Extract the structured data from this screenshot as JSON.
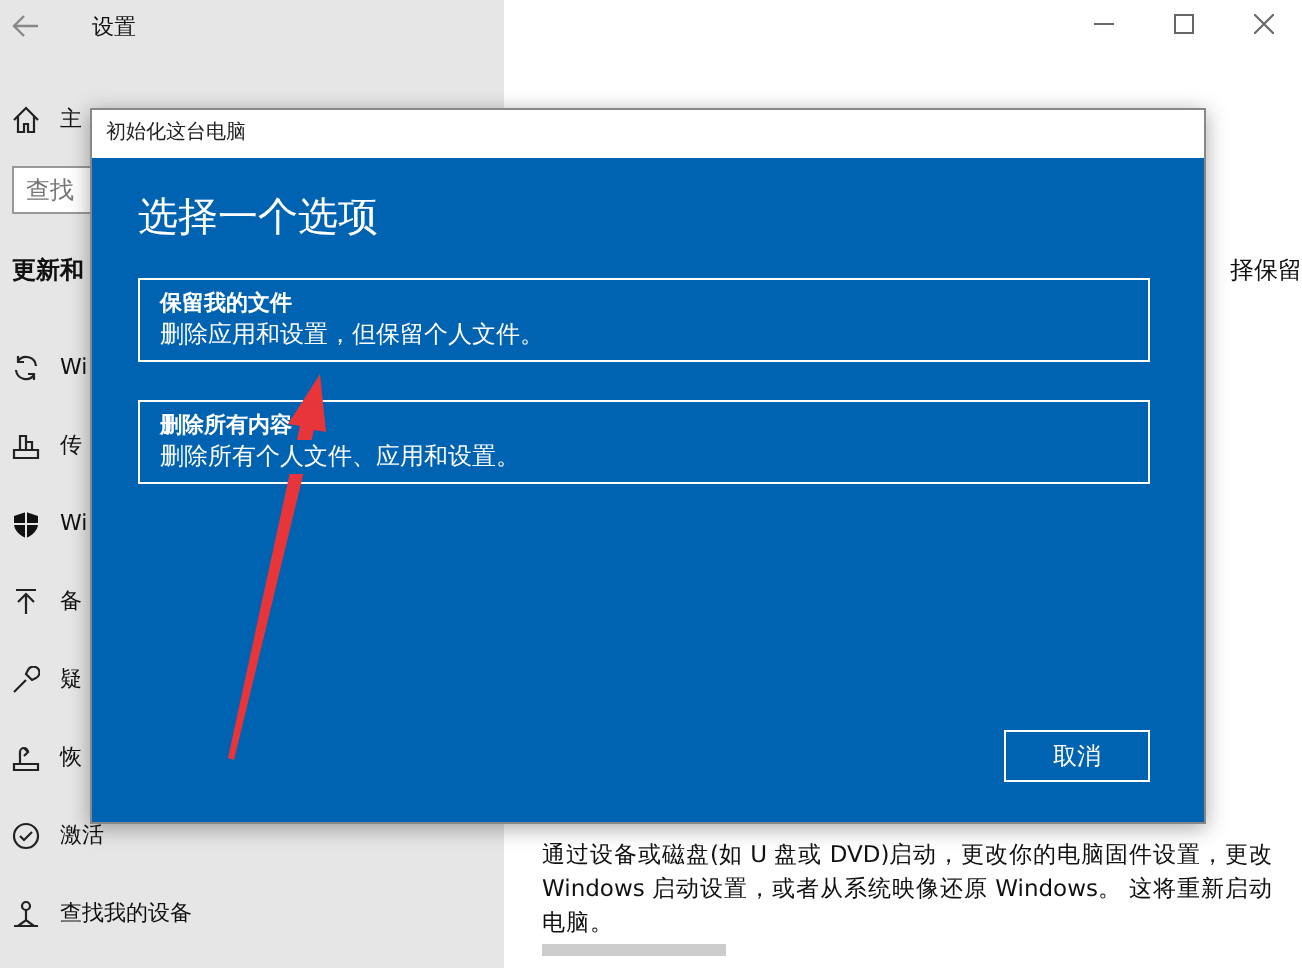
{
  "settings_window": {
    "title": "设置",
    "home": "主",
    "search": {
      "placeholder": "查找"
    },
    "section": "更新和",
    "sidebar": {
      "items": [
        {
          "label": "Wi"
        },
        {
          "label": "传"
        },
        {
          "label": "Wi"
        },
        {
          "label": "备"
        },
        {
          "label": "疑"
        },
        {
          "label": "恢"
        },
        {
          "label": "激活"
        },
        {
          "label": "查找我的设备"
        }
      ]
    },
    "content": {
      "side_text": "择保留",
      "advanced_description": "通过设备或磁盘(如 U 盘或 DVD)启动，更改你的电脑固件设置，更改 Windows 启动设置，或者从系统映像还原 Windows。 这将重新启动电脑。"
    }
  },
  "dialog": {
    "title": "初始化这台电脑",
    "heading": "选择一个选项",
    "options": [
      {
        "title": "保留我的文件",
        "description": "删除应用和设置，但保留个人文件。"
      },
      {
        "title": "删除所有内容",
        "description": "删除所有个人文件、应用和设置。"
      }
    ],
    "cancel": "取消"
  }
}
